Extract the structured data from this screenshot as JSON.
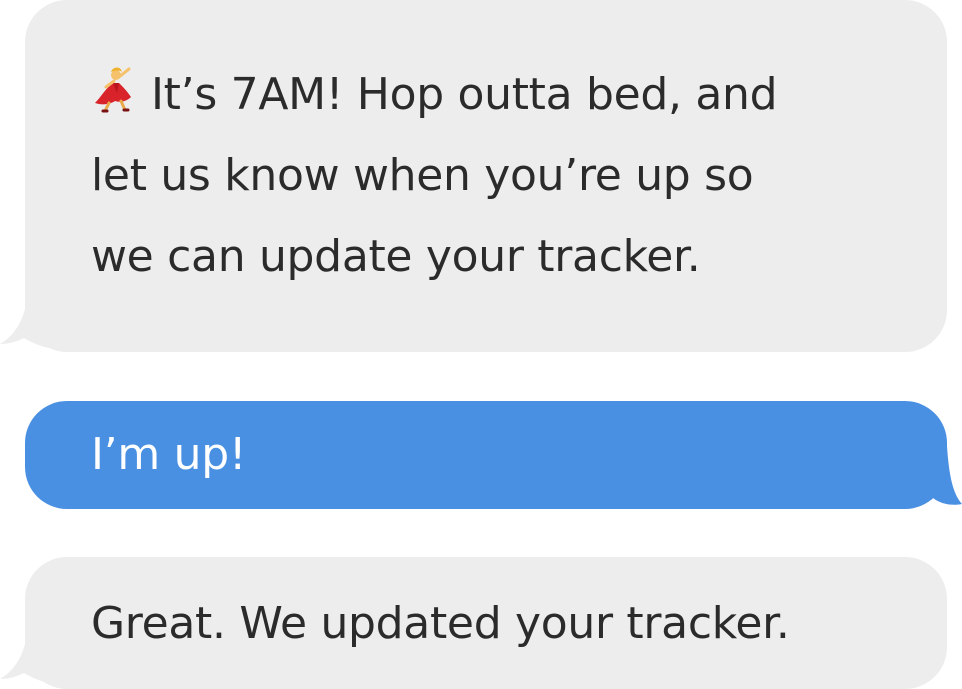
{
  "messages": [
    {
      "direction": "received",
      "icon": "dancer-emoji-icon",
      "lines": [
        "It’s 7AM! Hop outta bed, and",
        "let us know when you’re up so",
        "we can update your tracker."
      ]
    },
    {
      "direction": "sent",
      "text": "I’m up!"
    },
    {
      "direction": "received",
      "text": "Great. We updated your tracker."
    }
  ],
  "colors": {
    "received_bubble": "#ededed",
    "sent_bubble": "#4a90e2",
    "received_text": "#2b2b2b",
    "sent_text": "#ffffff"
  }
}
